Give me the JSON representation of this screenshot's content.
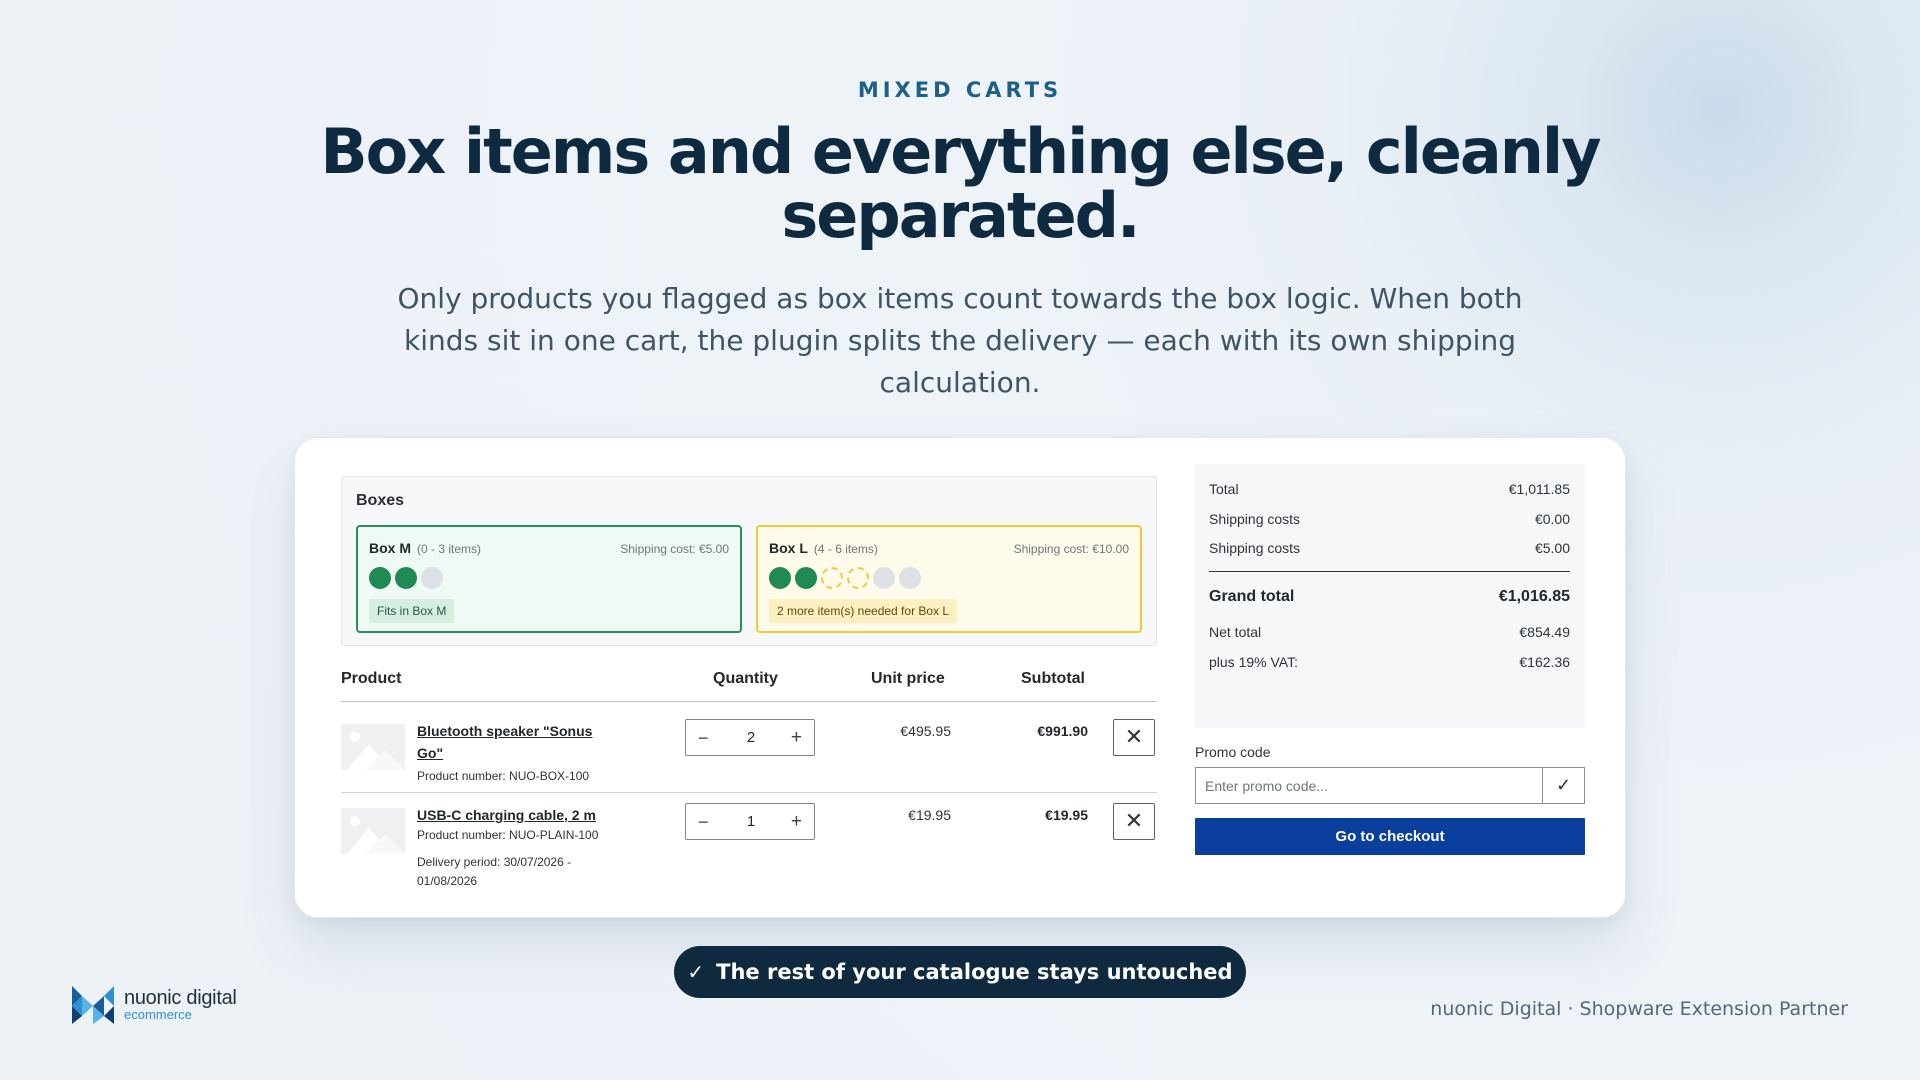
{
  "hero": {
    "eyebrow": "MIXED CARTS",
    "headline": "Box items and everything else, cleanly separated.",
    "subtext": "Only products you flagged as box items count towards the box logic. When both kinds sit in one cart, the plugin splits the delivery — each with its own shipping calculation."
  },
  "boxes": {
    "title": "Boxes",
    "items": [
      {
        "name": "Box M",
        "range": "(0 - 3 items)",
        "shipping": "Shipping cost: €5.00",
        "badge": "Fits in Box M",
        "filled": 2,
        "needed": 0,
        "capacity": 3,
        "accent": "#2c8d5a"
      },
      {
        "name": "Box L",
        "range": "(4 - 6 items)",
        "shipping": "Shipping cost: €10.00",
        "badge": "2 more item(s) needed for Box L",
        "filled": 2,
        "needed": 2,
        "capacity": 6,
        "accent": "#f1c838"
      }
    ]
  },
  "table": {
    "headers": {
      "product": "Product",
      "quantity": "Quantity",
      "unit_price": "Unit price",
      "subtotal": "Subtotal"
    },
    "rows": [
      {
        "name": "Bluetooth speaker \"Sonus Go\"",
        "number": "Product number: NUO-BOX-100",
        "delivery": "",
        "quantity": "2",
        "unit_price": "€495.95",
        "subtotal": "€991.90"
      },
      {
        "name": "USB-C charging cable, 2 m",
        "number": "Product number: NUO-PLAIN-100",
        "delivery": "Delivery period: 30/07/2026 - 01/08/2026",
        "quantity": "1",
        "unit_price": "€19.95",
        "subtotal": "€19.95"
      }
    ]
  },
  "summary": {
    "total_label": "Total",
    "total": "€1,011.85",
    "shipping1_label": "Shipping costs",
    "shipping1": "€0.00",
    "shipping2_label": "Shipping costs",
    "shipping2": "€5.00",
    "grand_label": "Grand total",
    "grand": "€1,016.85",
    "net_label": "Net total",
    "net": "€854.49",
    "vat_label": "plus 19% VAT:",
    "vat": "€162.36"
  },
  "promo": {
    "label": "Promo code",
    "placeholder": "Enter promo code..."
  },
  "checkout_label": "Go to checkout",
  "pill_label": "The rest of your catalogue stays untouched",
  "footer": {
    "logo_name": "nuonic digital",
    "logo_sub": "ecommerce",
    "partner": "nuonic Digital · Shopware Extension Partner"
  },
  "colors": {
    "primary": "#0b3f9e",
    "navy": "#0f2a3f",
    "success": "#1f8a53",
    "warning": "#f1c838"
  },
  "icons": {
    "remove": "close-icon",
    "promo_submit": "check-icon",
    "pill": "check-icon",
    "stepper_minus": "minus-icon",
    "stepper_plus": "plus-icon"
  }
}
